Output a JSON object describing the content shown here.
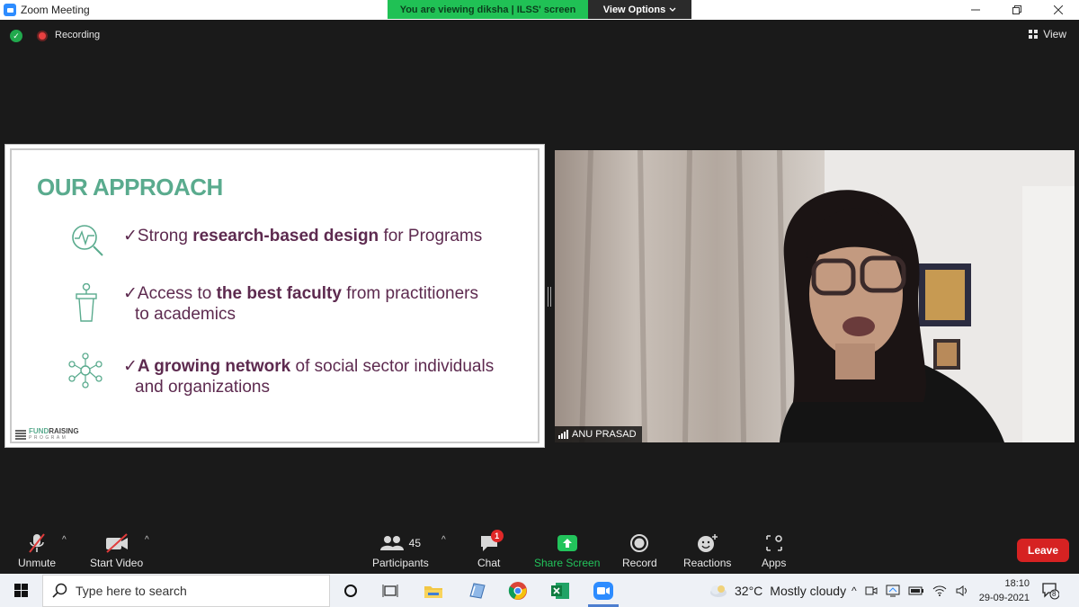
{
  "window": {
    "title": "Zoom Meeting",
    "viewing_banner": "You are viewing diksha | ILSS' screen",
    "view_options_label": "View Options",
    "recording_label": "Recording",
    "view_label": "View"
  },
  "slide": {
    "title": "OUR APPROACH",
    "bullets": [
      {
        "check": "✓",
        "pre": "Strong ",
        "bold": "research-based design",
        "post": " for Programs",
        "cont": ""
      },
      {
        "check": "✓",
        "pre": "Access to ",
        "bold": "the best faculty",
        "post": " from practitioners",
        "cont": "to academics"
      },
      {
        "check": "✓",
        "pre": "",
        "bold": "A growing network",
        "post": " of social sector individuals",
        "cont": "and organizations"
      }
    ],
    "logo_main_a": "FUND",
    "logo_main_b": "RAISING",
    "logo_sub": "PROGRAM",
    "icons": [
      "research-magnifier-icon",
      "podium-icon",
      "network-icon"
    ]
  },
  "video": {
    "participant_name": "ANU PRASAD"
  },
  "toolbar": {
    "unmute": "Unmute",
    "start_video": "Start Video",
    "participants": "Participants",
    "participant_count": "45",
    "chat": "Chat",
    "chat_badge": "1",
    "share_screen": "Share Screen",
    "record": "Record",
    "reactions": "Reactions",
    "apps": "Apps",
    "leave": "Leave"
  },
  "taskbar": {
    "search_placeholder": "Type here to search",
    "temperature": "32°C",
    "weather": "Mostly cloudy",
    "time": "18:10",
    "date": "29-09-2021",
    "notification_count": "8"
  },
  "colors": {
    "accent_green": "#20c155",
    "slide_title_green": "#5aab8e",
    "bullet_plum": "#5d2a4f",
    "leave_red": "#d62222"
  }
}
